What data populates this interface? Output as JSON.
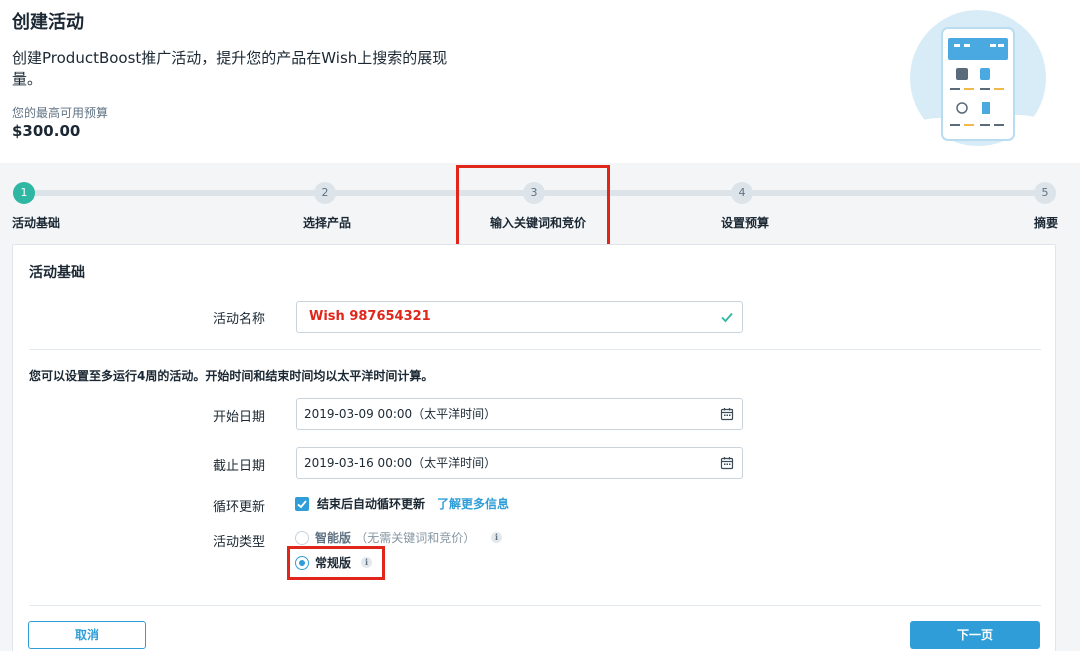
{
  "colors": {
    "accent": "#2f9ed8",
    "step_active": "#2fb7a4",
    "highlight": "#e0261b"
  },
  "header": {
    "title": "创建活动",
    "subtitle": "创建ProductBoost推广活动，提升您的产品在Wish上搜索的展现量。",
    "budget_label": "您的最高可用预算",
    "budget_value": "$300.00"
  },
  "stepper": {
    "steps": [
      {
        "number": "1",
        "label": "活动基础",
        "active": true
      },
      {
        "number": "2",
        "label": "选择产品",
        "active": false
      },
      {
        "number": "3",
        "label": "输入关键词和竞价",
        "active": false
      },
      {
        "number": "4",
        "label": "设置预算",
        "active": false
      },
      {
        "number": "5",
        "label": "摘要",
        "active": false
      }
    ]
  },
  "form": {
    "section_title": "活动基础",
    "campaign_name_label": "活动名称",
    "campaign_name_value": "Wish 987654321",
    "duration_notice": "您可以设置至多运行4周的活动。开始时间和结束时间均以太平洋时间计算。",
    "start_date_label": "开始日期",
    "start_date_value": "2019-03-09 00:00（太平洋时间）",
    "end_date_label": "截止日期",
    "end_date_value": "2019-03-16 00:00（太平洋时间）",
    "renew_label": "循环更新",
    "renew_checkbox_label": "结束后自动循环更新",
    "renew_checked": true,
    "learn_more": "了解更多信息",
    "type_label": "活动类型",
    "type_options": [
      {
        "label": "智能版",
        "desc": "（无需关键词和竞价）",
        "selected": false
      },
      {
        "label": "常规版",
        "desc": "",
        "selected": true
      }
    ],
    "info_glyph": "i"
  },
  "buttons": {
    "cancel": "取消",
    "next": "下一页"
  }
}
